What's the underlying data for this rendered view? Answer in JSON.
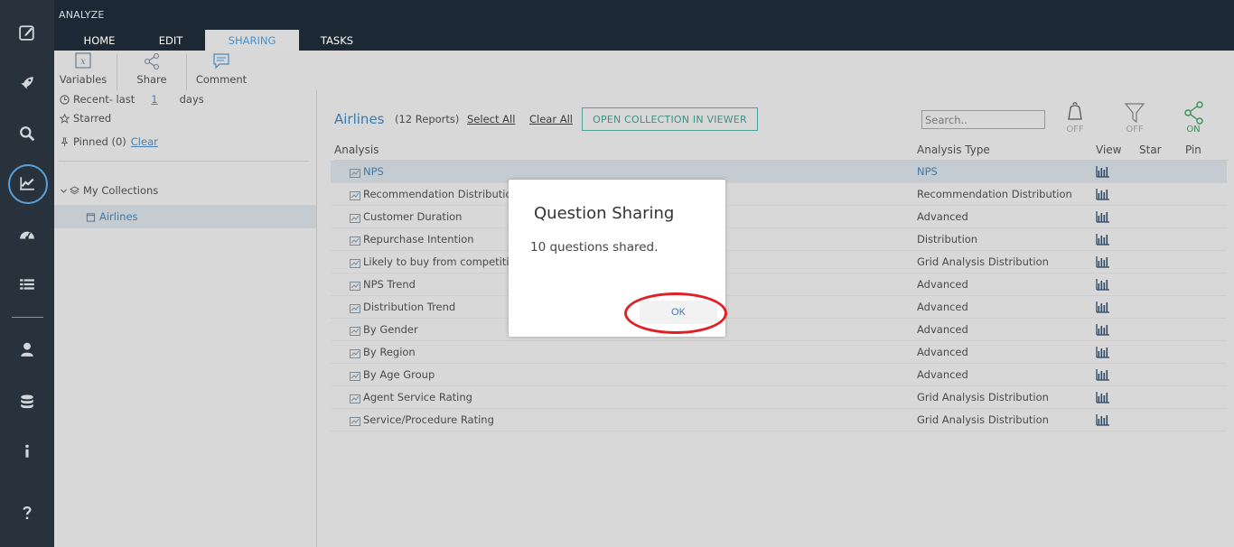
{
  "app": {
    "title": "ANALYZE"
  },
  "tabs": [
    {
      "label": "HOME",
      "active": false
    },
    {
      "label": "EDIT",
      "active": false
    },
    {
      "label": "SHARING",
      "active": true
    },
    {
      "label": "TASKS",
      "active": false
    }
  ],
  "ribbon": {
    "variables_label": "Variables",
    "variables_glyph": "x",
    "share_label": "Share",
    "comment_label": "Comment"
  },
  "left_panel": {
    "recent_label": "Recent- last",
    "recent_days": "1",
    "days_label": "days",
    "starred_label": "Starred",
    "pinned_label": "Pinned (0)",
    "clear_label": "Clear",
    "my_collections_label": "My Collections",
    "collection_item": "Airlines"
  },
  "main": {
    "collection_title": "Airlines",
    "report_count": "(12 Reports)",
    "select_all": "Select All",
    "clear_all": "Clear All",
    "open_viewer": "OPEN COLLECTION IN VIEWER",
    "search_placeholder": "Search..",
    "bell_state": "OFF",
    "filter_state": "OFF",
    "share_state": "ON",
    "columns": {
      "analysis": "Analysis",
      "type": "Analysis Type",
      "view": "View",
      "star": "Star",
      "pin": "Pin"
    },
    "rows": [
      {
        "name": "NPS",
        "type": "NPS",
        "selected": true
      },
      {
        "name": "Recommendation Distributio",
        "type": "Recommendation Distribution",
        "selected": false
      },
      {
        "name": "Customer Duration",
        "type": "Advanced",
        "selected": false
      },
      {
        "name": "Repurchase Intention",
        "type": "Distribution",
        "selected": false
      },
      {
        "name": "Likely to buy from competiti",
        "type": "Grid Analysis Distribution",
        "selected": false
      },
      {
        "name": "NPS Trend",
        "type": "Advanced",
        "selected": false
      },
      {
        "name": "Distribution Trend",
        "type": "Advanced",
        "selected": false
      },
      {
        "name": "By Gender",
        "type": "Advanced",
        "selected": false
      },
      {
        "name": "By Region",
        "type": "Advanced",
        "selected": false
      },
      {
        "name": "By Age Group",
        "type": "Advanced",
        "selected": false
      },
      {
        "name": "Agent Service Rating",
        "type": "Grid Analysis Distribution",
        "selected": false
      },
      {
        "name": "Service/Procedure Rating",
        "type": "Grid Analysis Distribution",
        "selected": false
      }
    ]
  },
  "dialog": {
    "title": "Question Sharing",
    "message": "10 questions shared.",
    "ok_label": "OK"
  },
  "colors": {
    "accent": "#4a90c8",
    "highlight_ring": "#e21f26",
    "rail": "#27323d",
    "header": "#1c2833"
  }
}
